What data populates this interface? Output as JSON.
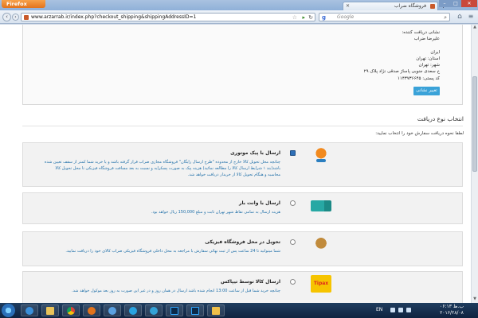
{
  "browser": {
    "app_button": "Firefox",
    "tab_title": "فروشگاه ضراب",
    "url": "www.arzarrab.ir/index.php?checkout_shipping&shippingAddressID=1",
    "search_placeholder": "Google",
    "search_engine_letter": "g"
  },
  "address": {
    "lines": [
      "نشانی دریافت کننده:",
      "علیرضا ضراب",
      "",
      "ایران",
      "استان: تهران",
      "شهر: تهران",
      "خ سعدی جنوبی پاساژ صدقی نژاد پلاک ۲۹",
      "کد پستی: ۱۱۴۳۷۳۶۶۴۵"
    ],
    "change_button": "تغییر نشانی"
  },
  "shipping": {
    "title": "انتخاب نوع دریافت",
    "hint": "لطفا نحوه دریافت سفارش خود را انتخاب نمایید:",
    "methods": [
      {
        "name": "ارسال با پیک موتوری",
        "description": "چنانچه محل تحویل کالا خارج از محدوده \"طرح ارسال رایگان\" فروشگاه مجازی ضراب قرار گرفته باشد و یا خرید شما کمتر از سقف تعیین شده باشد(بند ۱ شرایط ارسال کالا را مطالعه نمائید) هزینه پیک به صورت پسکرایه و نسبت به بعد مسافت فروشگاه فیزیکی تا محل تحویل کالا محاسبه و هنگام تحویل کالا از خریدار دریافت خواهد شد.",
        "icon": "motorbike-courier-icon",
        "selected": true
      },
      {
        "name": "ارسال با وانت بار",
        "description": "هزینه ارسال به تمامی نقاط شهر تهران ثابت و مبلغ 150,000 ریال خواهد بود.",
        "icon": "van-truck-icon",
        "selected": false
      },
      {
        "name": "تحویل در محل فروشگاه فیزیکی",
        "description": "شما میتوانید تا 24 ساعت پس از ثبت نهائی سفارش با مراجعه به محل داخلی فروشگاه فیزیکی ضراب کالای خود را دریافت نمایید.",
        "icon": "store-pickup-icon",
        "selected": false
      },
      {
        "name": "ارسال کالا توسط تیپاکس",
        "description": "چنانچه خرید شما قبل از ساعت 13:00 انجام شده باشد ارسال در همان روز و در غیر این صورت به روز بعد موکول خواهد شد.",
        "icon": "tipax-logo",
        "logo_text": "Tipax",
        "selected": false
      }
    ]
  },
  "taskbar": {
    "language": "EN",
    "time": "۰۶:۱۳ ب.ظ",
    "date": "۲۰۱۶/۲۸/۰۸"
  },
  "colors": {
    "accent_blue": "#3aa2d8",
    "description_blue": "#1f6fa8",
    "firefox_orange": "#e2731c"
  }
}
